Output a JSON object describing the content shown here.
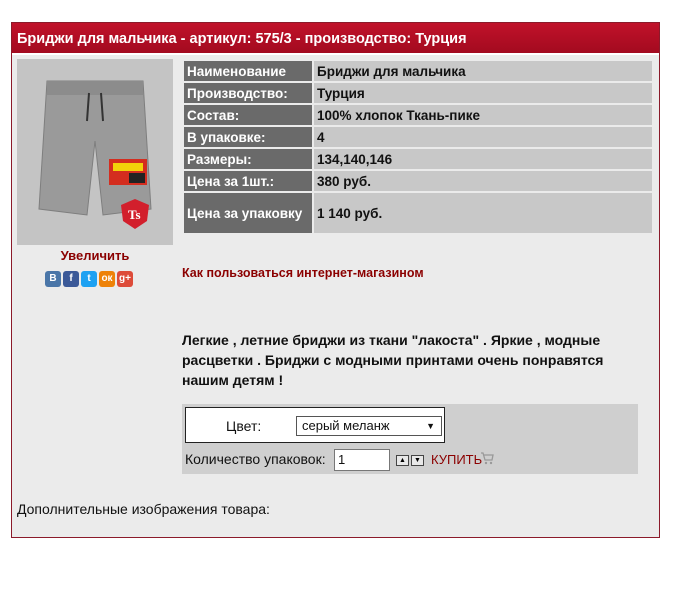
{
  "header": {
    "title": "Бриджи для мальчика - артикул: 575/3 - производство: Турция"
  },
  "image": {
    "zoom_label": "Увеличить"
  },
  "social": {
    "icons": [
      {
        "name": "vk-icon",
        "glyph": "В",
        "color": "#4a76a8"
      },
      {
        "name": "facebook-icon",
        "glyph": "f",
        "color": "#3b5998"
      },
      {
        "name": "twitter-icon",
        "glyph": "t",
        "color": "#1da1f2"
      },
      {
        "name": "odnoklassniki-icon",
        "glyph": "ок",
        "color": "#ee8208"
      },
      {
        "name": "google-plus-icon",
        "glyph": "g+",
        "color": "#dd4b39"
      }
    ]
  },
  "specs": [
    {
      "label": "Наименование",
      "value": "Бриджи для мальчика"
    },
    {
      "label": "Производство:",
      "value": "Турция"
    },
    {
      "label": "Состав:",
      "value": "100% хлопок Ткань-пике"
    },
    {
      "label": "В упаковке:",
      "value": "4"
    },
    {
      "label": "Размеры:",
      "value": "134,140,146"
    },
    {
      "label": "Цена за 1шт.:",
      "value": "380 руб."
    },
    {
      "label": "Цена за упаковку",
      "value": "1 140 руб."
    }
  ],
  "howto_link": "Как пользоваться интернет-магазином",
  "description": "Легкие , летние бриджи из ткани \"лакоста\" . Яркие , модные расцветки . Бриджи с модными принтами очень понравятся нашим детям !",
  "order": {
    "color_label": "Цвет:",
    "color_selected": "серый меланж",
    "qty_label": "Количество упаковок:",
    "qty_value": "1",
    "buy_label": "КУПИТЬ"
  },
  "extra_images_label": "Дополнительные изображения товара:"
}
